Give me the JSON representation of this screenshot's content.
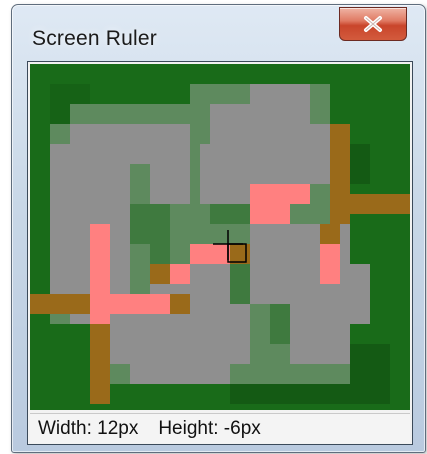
{
  "window": {
    "title": "Screen Ruler",
    "close_label": "Close"
  },
  "colors": {
    "background": "#196b19",
    "glyph": "#8f8f8f",
    "edge": "#5f8c5f",
    "highlight": "#ff8080",
    "guide": "#9a6a1a",
    "crosshair": "#000000"
  },
  "status": {
    "width_text": "Width: 12px",
    "height_text": "Height: -6px"
  }
}
